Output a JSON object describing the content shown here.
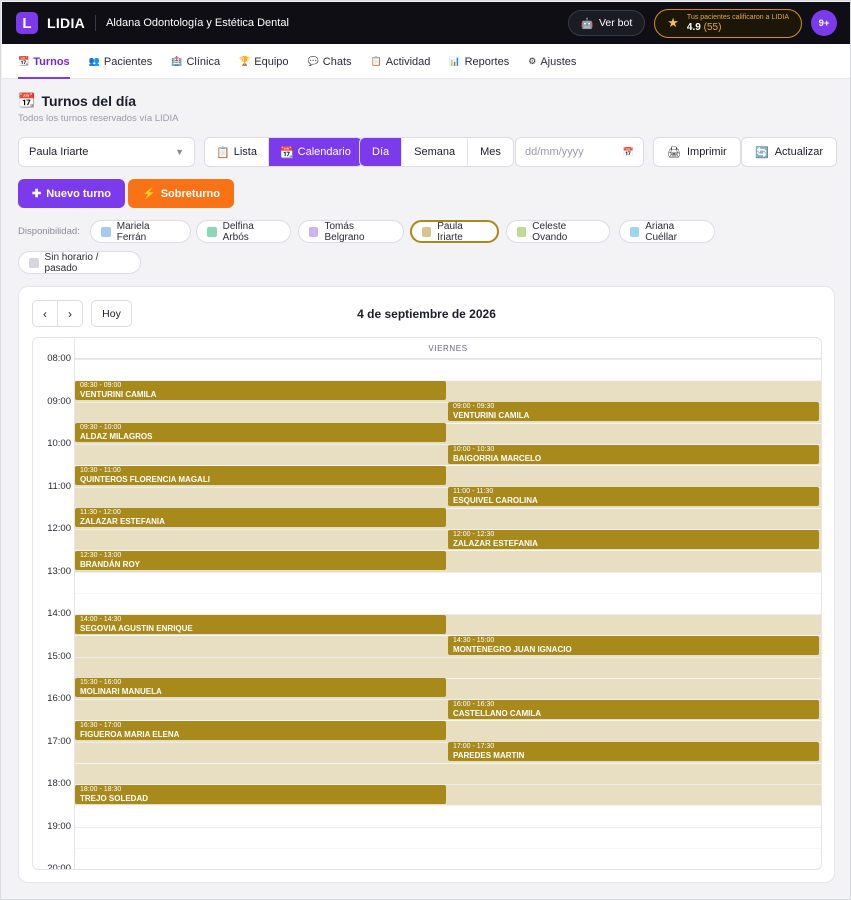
{
  "topbar": {
    "logo_letter": "L",
    "brand": "LIDIA",
    "clinic_name": "Aldana Odontología y Estética Dental",
    "bot_label": "Ver bot",
    "rating_caption": "Tus pacientes calificaron a LIDIA",
    "rating_value": "4.9",
    "rating_count": "(55)",
    "notif_count": "9+"
  },
  "nav": [
    {
      "label": "Turnos",
      "icon": "calendar-icon",
      "glyph": "📆",
      "active": true
    },
    {
      "label": "Pacientes",
      "icon": "users-icon",
      "glyph": "👥"
    },
    {
      "label": "Clínica",
      "icon": "hospital-icon",
      "glyph": "🏥"
    },
    {
      "label": "Equipo",
      "icon": "trophy-icon",
      "glyph": "🏆"
    },
    {
      "label": "Chats",
      "icon": "chat-icon",
      "glyph": "💬"
    },
    {
      "label": "Actividad",
      "icon": "list-icon",
      "glyph": "📋"
    },
    {
      "label": "Reportes",
      "icon": "chart-icon",
      "glyph": "📊"
    },
    {
      "label": "Ajustes",
      "icon": "gear-icon",
      "glyph": "⚙"
    }
  ],
  "page": {
    "title": "Turnos del día",
    "subtitle": "Todos los turnos reservados vía LIDIA"
  },
  "controls": {
    "professional": "Paula Iriarte",
    "view_list": "Lista",
    "view_calendar": "Calendario",
    "range_day": "Día",
    "range_week": "Semana",
    "range_month": "Mes",
    "date_placeholder": "dd/mm/yyyy",
    "print": "Imprimir",
    "refresh": "Actualizar",
    "new_appt": "Nuevo turno",
    "overbook": "Sobreturno"
  },
  "availability": {
    "label": "Disponibilidad:",
    "professionals": [
      {
        "name": "Mariela Ferrán",
        "color": "#a9c9ec"
      },
      {
        "name": "Delfina Arbós",
        "color": "#8fd7b9"
      },
      {
        "name": "Tomás Belgrano",
        "color": "#cdb3ef"
      },
      {
        "name": "Paula Iriarte",
        "color": "#d9c48d",
        "selected": true
      },
      {
        "name": "Celeste Ovando",
        "color": "#bedb93"
      },
      {
        "name": "Ariana Cuéllar",
        "color": "#9bd8ee"
      }
    ],
    "no_schedule": {
      "name": "Sin horario / pasado",
      "color": "#d6d6dc"
    }
  },
  "calendar": {
    "date_title": "4 de septiembre de 2026",
    "today": "Hoy",
    "day_header": "VIERNES",
    "hours": [
      "08:00",
      "09:00",
      "10:00",
      "11:00",
      "12:00",
      "13:00",
      "14:00",
      "15:00",
      "16:00",
      "17:00",
      "18:00",
      "19:00",
      "20:00"
    ],
    "available_blocks": [
      {
        "start": "08:30",
        "end": "13:00"
      },
      {
        "start": "14:00",
        "end": "18:30"
      }
    ],
    "appointments": [
      {
        "time": "08:30 - 09:00",
        "patient": "VENTURINI CAMILA",
        "col": 0
      },
      {
        "time": "09:00 - 09:30",
        "patient": "VENTURINI CAMILA",
        "col": 1
      },
      {
        "time": "09:30 - 10:00",
        "patient": "ALDAZ MILAGROS",
        "col": 0
      },
      {
        "time": "10:00 - 10:30",
        "patient": "BAIGORRIA MARCELO",
        "col": 1
      },
      {
        "time": "10:30 - 11:00",
        "patient": "QUINTEROS FLORENCIA MAGALI",
        "col": 0
      },
      {
        "time": "11:00 - 11:30",
        "patient": "ESQUIVEL CAROLINA",
        "col": 1
      },
      {
        "time": "11:30 - 12:00",
        "patient": "ZALAZAR ESTEFANIA",
        "col": 0
      },
      {
        "time": "12:00 - 12:30",
        "patient": "ZALAZAR ESTEFANIA",
        "col": 1
      },
      {
        "time": "12:30 - 13:00",
        "patient": "BRANDÁN ROY",
        "col": 0
      },
      {
        "time": "14:00 - 14:30",
        "patient": "SEGOVIA AGUSTIN ENRIQUE",
        "col": 0
      },
      {
        "time": "14:30 - 15:00",
        "patient": "MONTENEGRO JUAN IGNACIO",
        "col": 1
      },
      {
        "time": "15:30 - 16:00",
        "patient": "MOLINARI MANUELA",
        "col": 0
      },
      {
        "time": "16:00 - 16:30",
        "patient": "CASTELLANO CAMILA",
        "col": 1
      },
      {
        "time": "16:30 - 17:00",
        "patient": "FIGUEROA MARIA ELENA",
        "col": 0
      },
      {
        "time": "17:00 - 17:30",
        "patient": "PAREDES MARTIN",
        "col": 1
      },
      {
        "time": "18:00 - 18:30",
        "patient": "TREJO SOLEDAD",
        "col": 0
      }
    ]
  }
}
